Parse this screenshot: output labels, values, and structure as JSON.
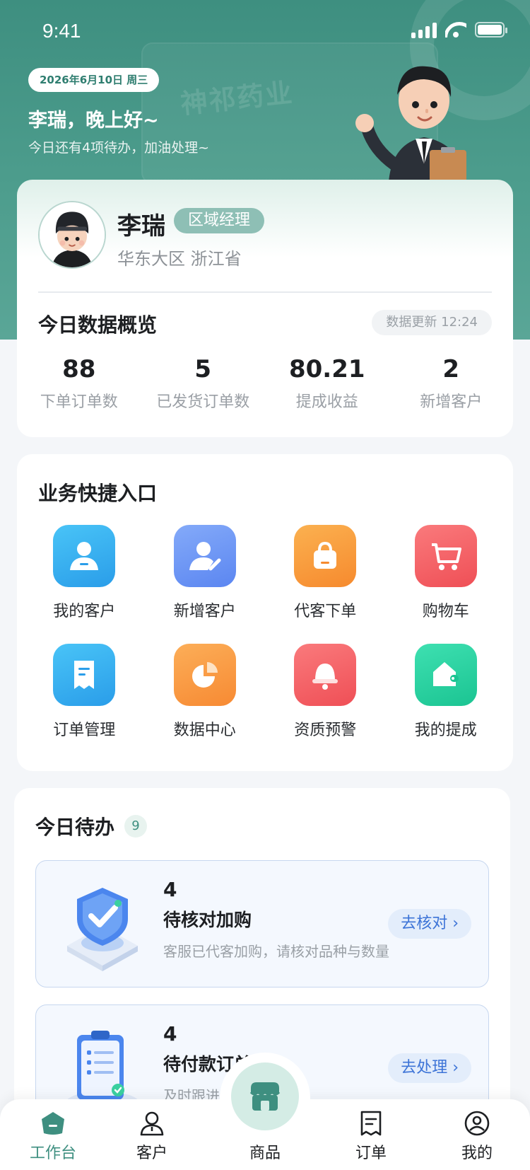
{
  "status_bar": {
    "time": "9:41"
  },
  "header": {
    "date": "2026年6月10日 周三",
    "greeting": "李瑞，晚上好~",
    "subtitle": "今日还有4项待办，加油处理~",
    "watermark": "神祁药业"
  },
  "profile": {
    "name": "李瑞",
    "role": "区域经理",
    "region": "华东大区 浙江省"
  },
  "overview": {
    "title": "今日数据概览",
    "update": "数据更新  12:24",
    "stats": [
      {
        "value": "88",
        "label": "下单订单数"
      },
      {
        "value": "5",
        "label": "已发货订单数"
      },
      {
        "value": "80.21",
        "label": "提成收益"
      },
      {
        "value": "2",
        "label": "新增客户"
      }
    ]
  },
  "quick": {
    "title": "业务快捷入口",
    "items": [
      {
        "label": "我的客户",
        "icon": "customer-icon",
        "color": "#3fb6f3"
      },
      {
        "label": "新增客户",
        "icon": "add-customer-icon",
        "color": "#6f9cf7"
      },
      {
        "label": "代客下单",
        "icon": "bag-icon",
        "color": "#f9a443"
      },
      {
        "label": "购物车",
        "icon": "cart-icon",
        "color": "#f76668"
      },
      {
        "label": "订单管理",
        "icon": "receipt-icon",
        "color": "#3fb6f3"
      },
      {
        "label": "数据中心",
        "icon": "pie-chart-icon",
        "color": "#fb9a45"
      },
      {
        "label": "资质预警",
        "icon": "bell-icon",
        "color": "#f76668"
      },
      {
        "label": "我的提成",
        "icon": "wallet-icon",
        "color": "#2fd5a3"
      }
    ]
  },
  "todo": {
    "title": "今日待办",
    "count": "9",
    "items": [
      {
        "num": "4",
        "name": "待核对加购",
        "desc": "客服已代客加购，请核对品种与数量",
        "action": "去核对 ›"
      },
      {
        "num": "4",
        "name": "待付款订单",
        "desc": "及时跟进客户付款进度",
        "action": "去处理 ›"
      }
    ]
  },
  "tabbar": {
    "items": [
      {
        "label": "工作台"
      },
      {
        "label": "客户"
      },
      {
        "label": "商品"
      },
      {
        "label": "订单"
      },
      {
        "label": "我的"
      }
    ],
    "active_color": "#3e8f80"
  }
}
